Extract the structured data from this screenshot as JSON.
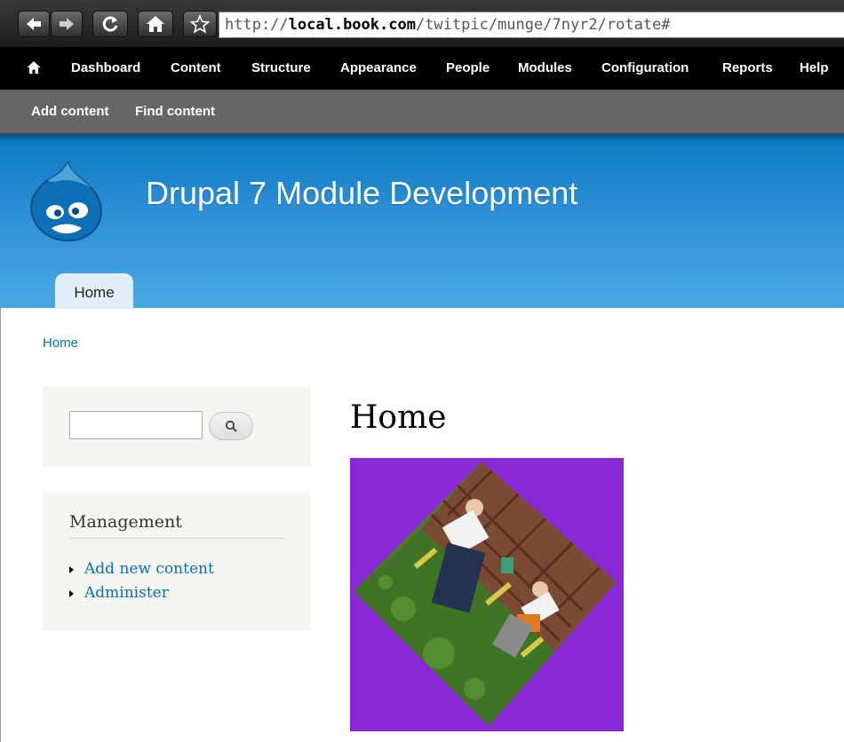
{
  "browser": {
    "url_prefix": "http://",
    "url_host": "local.book.com",
    "url_path": "/twitpic/munge/7nyr2/rotate#"
  },
  "toolbar": {
    "items": [
      "Dashboard",
      "Content",
      "Structure",
      "Appearance",
      "People",
      "Modules",
      "Configuration",
      "Reports",
      "Help"
    ],
    "shortcuts": [
      "Add content",
      "Find content"
    ]
  },
  "header": {
    "site_name": "Drupal 7 Module Development",
    "tabs": [
      "Home"
    ]
  },
  "breadcrumb": "Home",
  "search": {
    "value": "",
    "placeholder": ""
  },
  "management": {
    "title": "Management",
    "links": [
      "Add new content",
      "Administer"
    ]
  },
  "main": {
    "title": "Home"
  },
  "colors": {
    "toolbar_bg": "#000000",
    "shortcuts_bg": "#666666",
    "header_blue": "#2f8fd6",
    "link": "#0071b3",
    "photo_bg": "#8a28d6"
  },
  "icons": [
    "back-arrow-icon",
    "forward-arrow-icon",
    "reload-icon",
    "home-icon",
    "star-icon",
    "search-icon",
    "drupal-logo-icon"
  ]
}
